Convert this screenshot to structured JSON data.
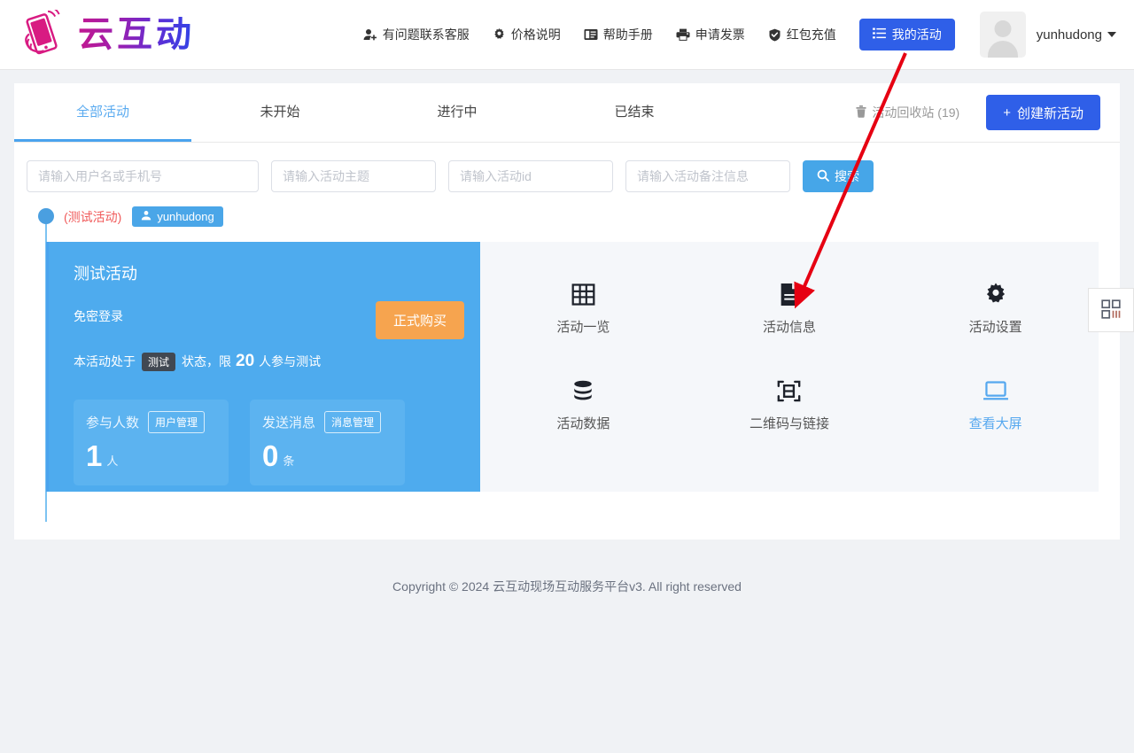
{
  "header": {
    "logo_text": "云互动",
    "logo_icon": "hand-phone-icon",
    "nav": [
      {
        "label": "有问题联系客服",
        "icon": "user-plus-icon"
      },
      {
        "label": "价格说明",
        "icon": "gear-icon"
      },
      {
        "label": "帮助手册",
        "icon": "book-icon"
      },
      {
        "label": "申请发票",
        "icon": "printer-icon"
      },
      {
        "label": "红包充值",
        "icon": "shield-check-icon"
      }
    ],
    "my_activity_button": {
      "label": "我的活动",
      "icon": "list-icon",
      "color": "#2f5fe8"
    },
    "user": {
      "name": "yunhudong",
      "avatar_icon": "avatar-placeholder-icon",
      "caret": "chevron-down-icon"
    }
  },
  "tabs": [
    {
      "label": "全部活动",
      "active": true
    },
    {
      "label": "未开始",
      "active": false
    },
    {
      "label": "进行中",
      "active": false
    },
    {
      "label": "已结束",
      "active": false
    }
  ],
  "toolbar": {
    "recycle_bin": {
      "label": "活动回收站 (19)",
      "icon": "trash-icon"
    },
    "create_button": {
      "label": "创建新活动",
      "prefix": "+",
      "color": "#2f5fe8"
    }
  },
  "search": {
    "fields": [
      {
        "placeholder": "请输入用户名或手机号",
        "value": ""
      },
      {
        "placeholder": "请输入活动主题",
        "value": ""
      },
      {
        "placeholder": "请输入活动id",
        "value": ""
      },
      {
        "placeholder": "请输入活动备注信息",
        "value": ""
      }
    ],
    "button": {
      "label": "搜索",
      "icon": "search-icon",
      "color": "#46a6e8"
    }
  },
  "activity": {
    "status_dot_color": "#4a9fe0",
    "test_label": "(测试活动)",
    "owner_badge": {
      "label": "yunhudong",
      "icon": "user-icon"
    },
    "card": {
      "title": "测试活动",
      "subtitle": "免密登录",
      "notice_prefix": "本活动处于",
      "notice_tag": "测试",
      "notice_middle": "状态，限",
      "notice_number": "20",
      "notice_suffix": "人参与测试",
      "buy_button": {
        "label": "正式购买",
        "color": "#f6a44f"
      },
      "stats": [
        {
          "label": "参与人数",
          "action": "用户管理",
          "value": "1",
          "unit": "人"
        },
        {
          "label": "发送消息",
          "action": "消息管理",
          "value": "0",
          "unit": "条"
        }
      ]
    },
    "tools": [
      {
        "label": "活动一览",
        "icon": "grid-icon",
        "highlight": false
      },
      {
        "label": "活动信息",
        "icon": "document-icon",
        "highlight": false
      },
      {
        "label": "活动设置",
        "icon": "gear-icon",
        "highlight": false
      },
      {
        "label": "活动数据",
        "icon": "database-icon",
        "highlight": false
      },
      {
        "label": "二维码与链接",
        "icon": "qrcode-scan-icon",
        "highlight": false
      },
      {
        "label": "查看大屏",
        "icon": "monitor-icon",
        "highlight": true
      }
    ]
  },
  "side_tab": {
    "icon": "qrcode-icon"
  },
  "footer": {
    "text": "Copyright © 2024 云互动现场互动服务平台v3. All right reserved"
  },
  "annotation": {
    "arrow_color": "#e60012",
    "from": "我的活动",
    "to": "活动信息"
  }
}
